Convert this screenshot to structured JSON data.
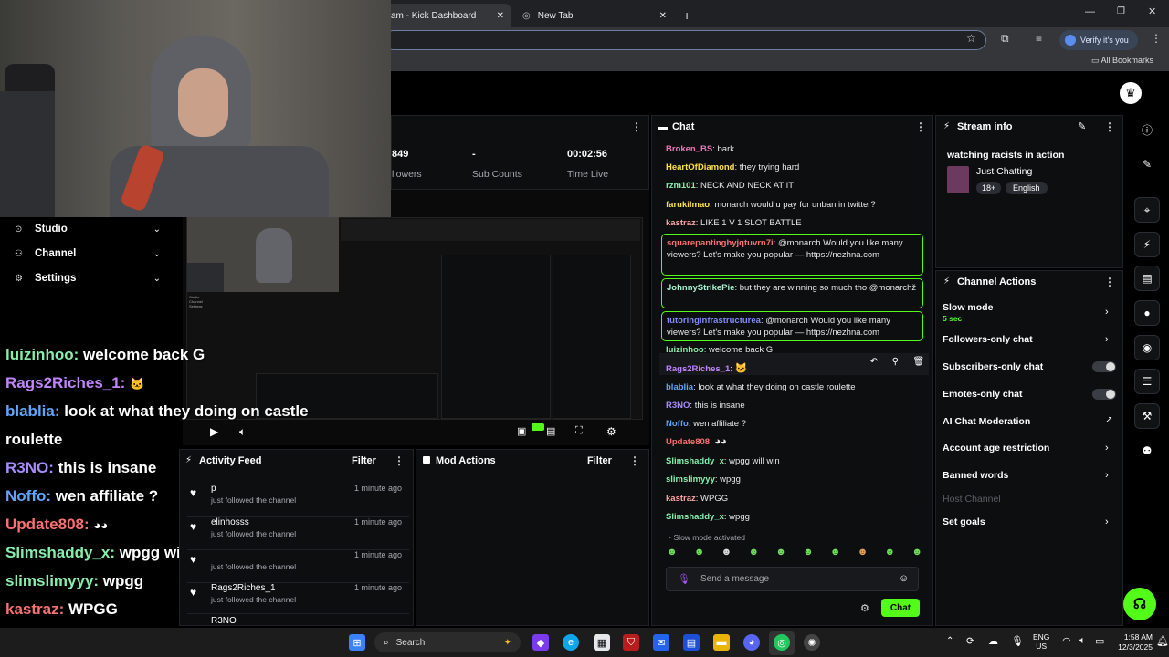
{
  "browser": {
    "tabs": [
      {
        "label": "am - Kick Dashboard",
        "active": true
      },
      {
        "label": "New Tab",
        "active": false
      }
    ],
    "new_tab": "+",
    "close": "✕",
    "verify": "Verify it's you",
    "bookmarks": "All Bookmarks"
  },
  "stats": {
    "followers_value": "849",
    "followers_label": "llowers",
    "subs_value": "-",
    "subs_label": "Sub Counts",
    "time_value": "00:02:56",
    "time_label": "Time Live"
  },
  "sidebar": {
    "items": [
      {
        "label": "Studio"
      },
      {
        "label": "Channel"
      },
      {
        "label": "Settings"
      }
    ]
  },
  "chat": {
    "title": "Chat",
    "messages": [
      {
        "user": "Broken_BS",
        "color": "#e879b9",
        "text": "bark"
      },
      {
        "user": "HeartOfDiamond",
        "color": "#fde047",
        "text": "they trying hard"
      },
      {
        "user": "rzm101",
        "color": "#86efac",
        "text": "NECK AND NECK AT IT"
      },
      {
        "user": "farukilmao",
        "color": "#fde047",
        "text": "monarch would u pay for unban in twitter?"
      },
      {
        "user": "kastraz",
        "color": "#fca5a5",
        "text": "LIKE 1 V 1 SLOT BATTLE"
      }
    ],
    "flagged": [
      {
        "user": "squarepantinghyjqtuvrn7i",
        "color": "#f87171",
        "text": "@monarch Would you like many viewers? Let's make you popular — https://nezhna.com"
      },
      {
        "user": "JohnnyStrikePie",
        "color": "#a7f3d0",
        "text": "but they are winning so much tho @monarchž"
      },
      {
        "user": "tutoringinfrastructurea",
        "color": "#818cf8",
        "text": "@monarch Would you like many viewers? Let's make you popular — https://nezhna.com"
      }
    ],
    "messages2": [
      {
        "user": "luizinhoo",
        "color": "#86efac",
        "text": "welcome back G"
      },
      {
        "user": "Rags2Riches_1",
        "color": "#c084fc",
        "text": ""
      },
      {
        "user": "blablia",
        "color": "#60a5fa",
        "text": "look at what they doing on castle roulette"
      },
      {
        "user": "R3NO",
        "color": "#a78bfa",
        "text": "this is insane"
      },
      {
        "user": "Noffo",
        "color": "#60a5fa",
        "text": "wen affiliate ?"
      },
      {
        "user": "Update808",
        "color": "#f87171",
        "text": ""
      },
      {
        "user": "Slimshaddy_x",
        "color": "#86efac",
        "text": "wpgg will win"
      },
      {
        "user": "slimslimyyy",
        "color": "#86efac",
        "text": "wpgg"
      },
      {
        "user": "kastraz",
        "color": "#fca5a5",
        "text": "WPGG"
      },
      {
        "user": "Slimshaddy_x",
        "color": "#86efac",
        "text": "wpgg"
      }
    ],
    "slow_mode": "Slow mode activated",
    "placeholder": "Send a message",
    "send": "Chat"
  },
  "stream_info": {
    "title": "Stream info",
    "stream_title": "watching racists in action",
    "category": "Just Chatting",
    "tags": [
      "18+",
      "English"
    ]
  },
  "channel_actions": {
    "title": "Channel Actions",
    "items": [
      {
        "label": "Slow mode",
        "sub": "5 sec"
      },
      {
        "label": "Followers-only chat"
      },
      {
        "label": "Subscribers-only chat"
      },
      {
        "label": "Emotes-only chat"
      },
      {
        "label": "AI Chat Moderation"
      },
      {
        "label": "Account age restriction"
      },
      {
        "label": "Banned words"
      },
      {
        "label": "Host Channel"
      },
      {
        "label": "Set goals"
      }
    ]
  },
  "activity_feed": {
    "title": "Activity Feed",
    "filter": "Filter",
    "rows": [
      {
        "name": "p",
        "sub": "just followed the channel",
        "time": "1 minute ago"
      },
      {
        "name": "elinhosss",
        "sub": "just followed the channel",
        "time": "1 minute ago"
      },
      {
        "name": "",
        "sub": "just followed the channel",
        "time": "1 minute ago"
      },
      {
        "name": "Rags2Riches_1",
        "sub": "just followed the channel",
        "time": "1 minute ago"
      },
      {
        "name": "R3NO",
        "sub": "",
        "time": ""
      }
    ]
  },
  "mod_actions": {
    "title": "Mod Actions",
    "filter": "Filter"
  },
  "overlay_chat": [
    {
      "user": "luizinhoo:",
      "color": "#86efac",
      "text": "welcome back G"
    },
    {
      "user": "Rags2Riches_1:",
      "color": "#c084fc",
      "text": ""
    },
    {
      "user": "blablia:",
      "color": "#60a5fa",
      "text": "look at what they doing on castle"
    },
    {
      "user": "",
      "color": "#fff",
      "text": "roulette"
    },
    {
      "user": "R3NO:",
      "color": "#a78bfa",
      "text": "this is insane"
    },
    {
      "user": "Noffo:",
      "color": "#60a5fa",
      "text": "wen affiliate ?"
    },
    {
      "user": "Update808:",
      "color": "#f87171",
      "text": ""
    },
    {
      "user": "Slimshaddy_x:",
      "color": "#86efac",
      "text": "wpgg will win"
    },
    {
      "user": "slimslimyyy:",
      "color": "#86efac",
      "text": "wpgg"
    },
    {
      "user": "kastraz:",
      "color": "#f87171",
      "text": "WPGG"
    }
  ],
  "taskbar": {
    "search": "Search",
    "lang": "ENG",
    "region": "US",
    "time": "1:58 AM",
    "date": "12/3/2025"
  }
}
